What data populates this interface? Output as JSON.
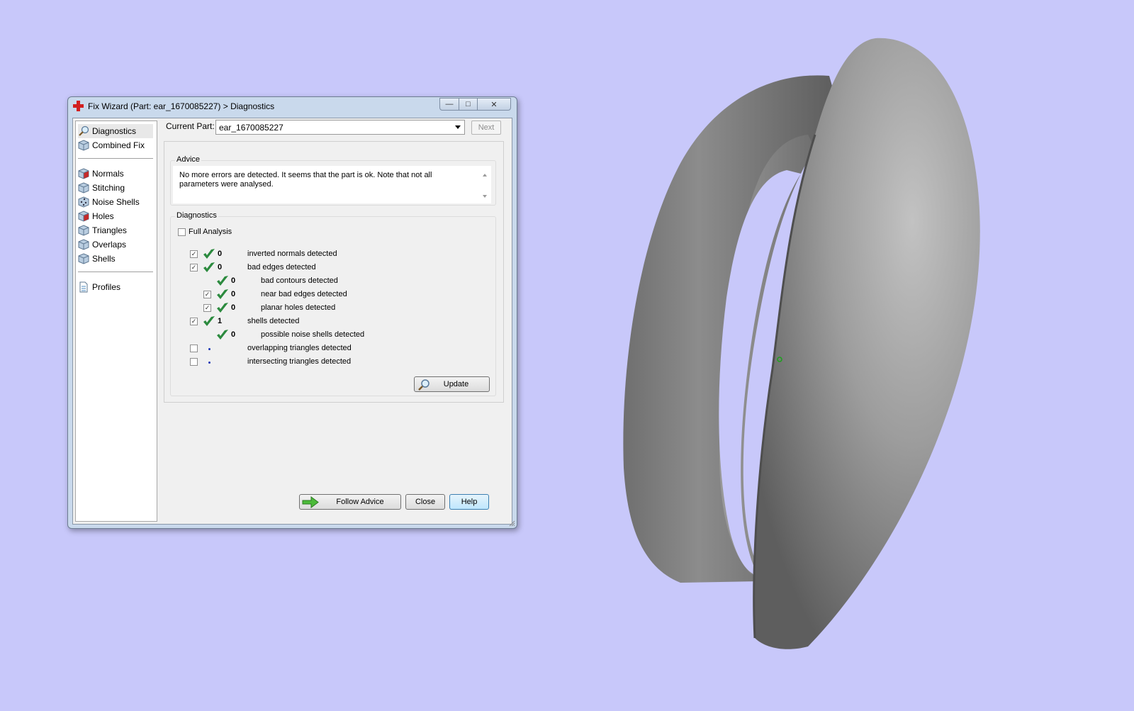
{
  "window": {
    "title": "Fix Wizard (Part: ear_1670085227) > Diagnostics",
    "controls": {
      "minimize": "—",
      "maximize": "□",
      "close": "✕"
    }
  },
  "sidebar": {
    "groups": [
      [
        {
          "label": "Diagnostics",
          "icon": "magnifier-icon",
          "selected": true
        },
        {
          "label": "Combined Fix",
          "icon": "cube-icon"
        }
      ],
      [
        {
          "label": "Normals",
          "icon": "red-cube-icon"
        },
        {
          "label": "Stitching",
          "icon": "cube-icon"
        },
        {
          "label": "Noise Shells",
          "icon": "dotted-cube-icon"
        },
        {
          "label": "Holes",
          "icon": "red-cube-icon"
        },
        {
          "label": "Triangles",
          "icon": "cube-icon"
        },
        {
          "label": "Overlaps",
          "icon": "cube-icon"
        },
        {
          "label": "Shells",
          "icon": "cube-icon"
        }
      ],
      [
        {
          "label": "Profiles",
          "icon": "document-icon"
        }
      ]
    ]
  },
  "current_part": {
    "label": "Current Part:",
    "value": "ear_1670085227",
    "next_button": "Next"
  },
  "advice": {
    "title": "Advice",
    "text": "No more errors are detected. It seems that the part is ok. Note that not all parameters were analysed."
  },
  "diagnostics": {
    "title": "Diagnostics",
    "full_analysis": {
      "label": "Full Analysis",
      "checked": false
    },
    "rows": [
      {
        "label": "inverted normals detected",
        "count": "0",
        "checkbox": true,
        "checked": true,
        "status": "ok",
        "indent": 0
      },
      {
        "label": "bad edges detected",
        "count": "0",
        "checkbox": true,
        "checked": true,
        "status": "ok",
        "indent": 0
      },
      {
        "label": "bad contours detected",
        "count": "0",
        "checkbox": false,
        "checked": false,
        "status": "ok",
        "indent": 1
      },
      {
        "label": "near bad edges detected",
        "count": "0",
        "checkbox": true,
        "checked": true,
        "status": "ok",
        "indent": 1
      },
      {
        "label": "planar holes detected",
        "count": "0",
        "checkbox": true,
        "checked": true,
        "status": "ok",
        "indent": 1
      },
      {
        "label": "shells detected",
        "count": "1",
        "checkbox": true,
        "checked": true,
        "status": "ok",
        "indent": 0
      },
      {
        "label": "possible noise shells detected",
        "count": "0",
        "checkbox": false,
        "checked": false,
        "status": "ok",
        "indent": 1
      },
      {
        "label": "overlapping triangles detected",
        "count": "",
        "checkbox": true,
        "checked": false,
        "status": "none",
        "indent": 0
      },
      {
        "label": "intersecting triangles detected",
        "count": "",
        "checkbox": true,
        "checked": false,
        "status": "none",
        "indent": 0
      }
    ],
    "update_button": "Update"
  },
  "buttons": {
    "follow_advice": "Follow Advice",
    "close": "Close",
    "help": "Help"
  },
  "colors": {
    "viewport_background": "#c8c8fa",
    "ok_check": "#2b8a3e",
    "model_gray": "#8a8a8a"
  }
}
